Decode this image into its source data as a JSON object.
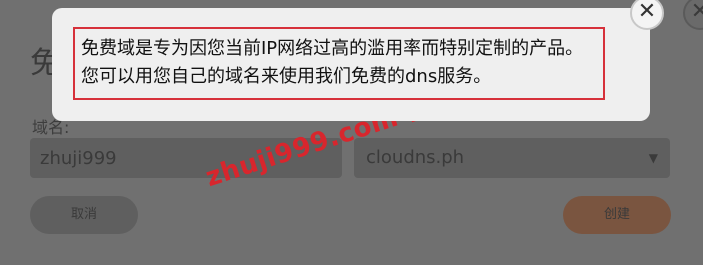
{
  "modal": {
    "title": "免",
    "domain_label": "域名:",
    "domain_value": "zhuji999",
    "suffix_value": "cloudns.ph",
    "cancel_label": "取消",
    "create_label": "创建"
  },
  "tooltip": {
    "text": "免费域是专为因您当前IP网络过高的滥用率而特别定制的产品。您可以用您自己的域名来使用我们免费的dns服务。"
  },
  "watermark": "zhuji999.com-主机玖玖",
  "icons": {
    "close": "close-icon",
    "chevron": "chevron-down-icon"
  },
  "colors": {
    "highlight_border": "#d6303a",
    "watermark": "#d8262d"
  }
}
